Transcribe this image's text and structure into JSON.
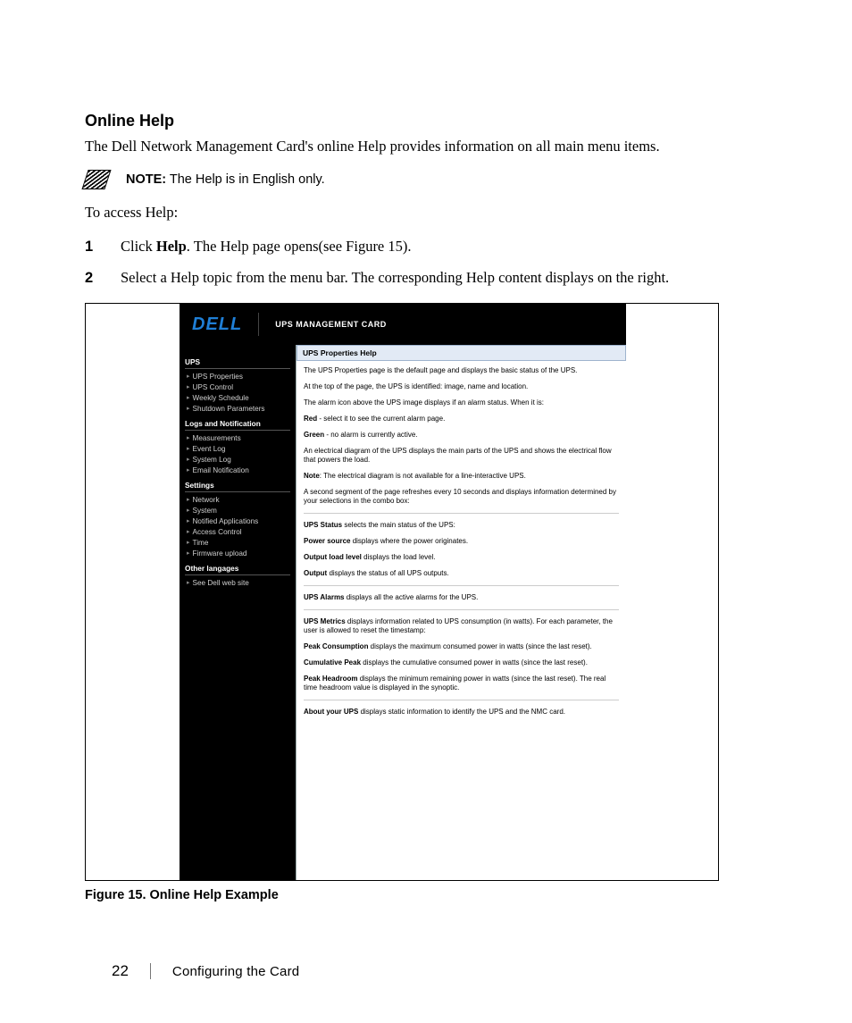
{
  "section": {
    "title": "Online Help",
    "intro": "The Dell Network Management Card's online Help provides information on all main menu items.",
    "note_label": "NOTE:",
    "note_text": "The Help is in English only.",
    "access": "To access Help:",
    "step1_a": "Click ",
    "step1_bold": "Help",
    "step1_b": ". The Help page opens(see Figure 15).",
    "step2": "Select a Help topic from the menu bar. The corresponding Help content displays on the right."
  },
  "screenshot": {
    "logo": "DELL",
    "header_title": "UPS MANAGEMENT CARD",
    "sidebar": {
      "g1_title": "UPS",
      "g1": [
        "UPS Properties",
        "UPS Control",
        "Weekly Schedule",
        "Shutdown Parameters"
      ],
      "g2_title": "Logs and Notification",
      "g2": [
        "Measurements",
        "Event Log",
        "System Log",
        "Email Notification"
      ],
      "g3_title": "Settings",
      "g3": [
        "Network",
        "System",
        "Notified Applications",
        "Access Control",
        "Time",
        "Firmware upload"
      ],
      "g4_title": "Other langages",
      "g4": [
        "See Dell web site"
      ]
    },
    "content": {
      "title": "UPS Properties Help",
      "p1": "The UPS Properties page is the default page and displays the basic status of the UPS.",
      "p2": "At the top of the page, the UPS is identified: image, name and location.",
      "p3": "The alarm icon above the UPS image displays if an alarm status. When it is:",
      "p4a": "Red",
      "p4b": " - select it to see the current alarm page.",
      "p5a": "Green",
      "p5b": " - no alarm is currently active.",
      "p6": "An electrical diagram of the UPS displays the main parts of the UPS and shows the electrical flow that powers the load.",
      "p7a": "Note",
      "p7b": ": The electrical diagram is not available for a line-interactive UPS.",
      "p8": "A second segment of the page refreshes every 10 seconds and displays information determined by your selections in the combo box:",
      "p9a": "UPS Status",
      "p9b": " selects the main status of the UPS:",
      "p10a": "Power source",
      "p10b": " displays where the power originates.",
      "p11a": "Output load level",
      "p11b": " displays the load level.",
      "p12a": "Output",
      "p12b": " displays the status of all UPS outputs.",
      "p13a": "UPS Alarms",
      "p13b": " displays all the active alarms for the UPS.",
      "p14a": "UPS Metrics",
      "p14b": " displays information related to UPS consumption (in watts). For each parameter, the user is allowed to reset the timestamp:",
      "p15a": "Peak Consumption",
      "p15b": " displays the maximum consumed power in watts (since the last reset).",
      "p16a": "Cumulative Peak",
      "p16b": " displays the cumulative consumed power in watts (since the last reset).",
      "p17a": "Peak Headroom",
      "p17b": " displays the minimum remaining power in watts (since the last reset). The real time headroom value is displayed in the synoptic.",
      "p18a": "About your UPS",
      "p18b": " displays static information to identify the UPS and the NMC card."
    }
  },
  "figure_caption": "Figure 15. Online Help Example",
  "footer": {
    "page": "22",
    "chapter": "Configuring the Card"
  }
}
